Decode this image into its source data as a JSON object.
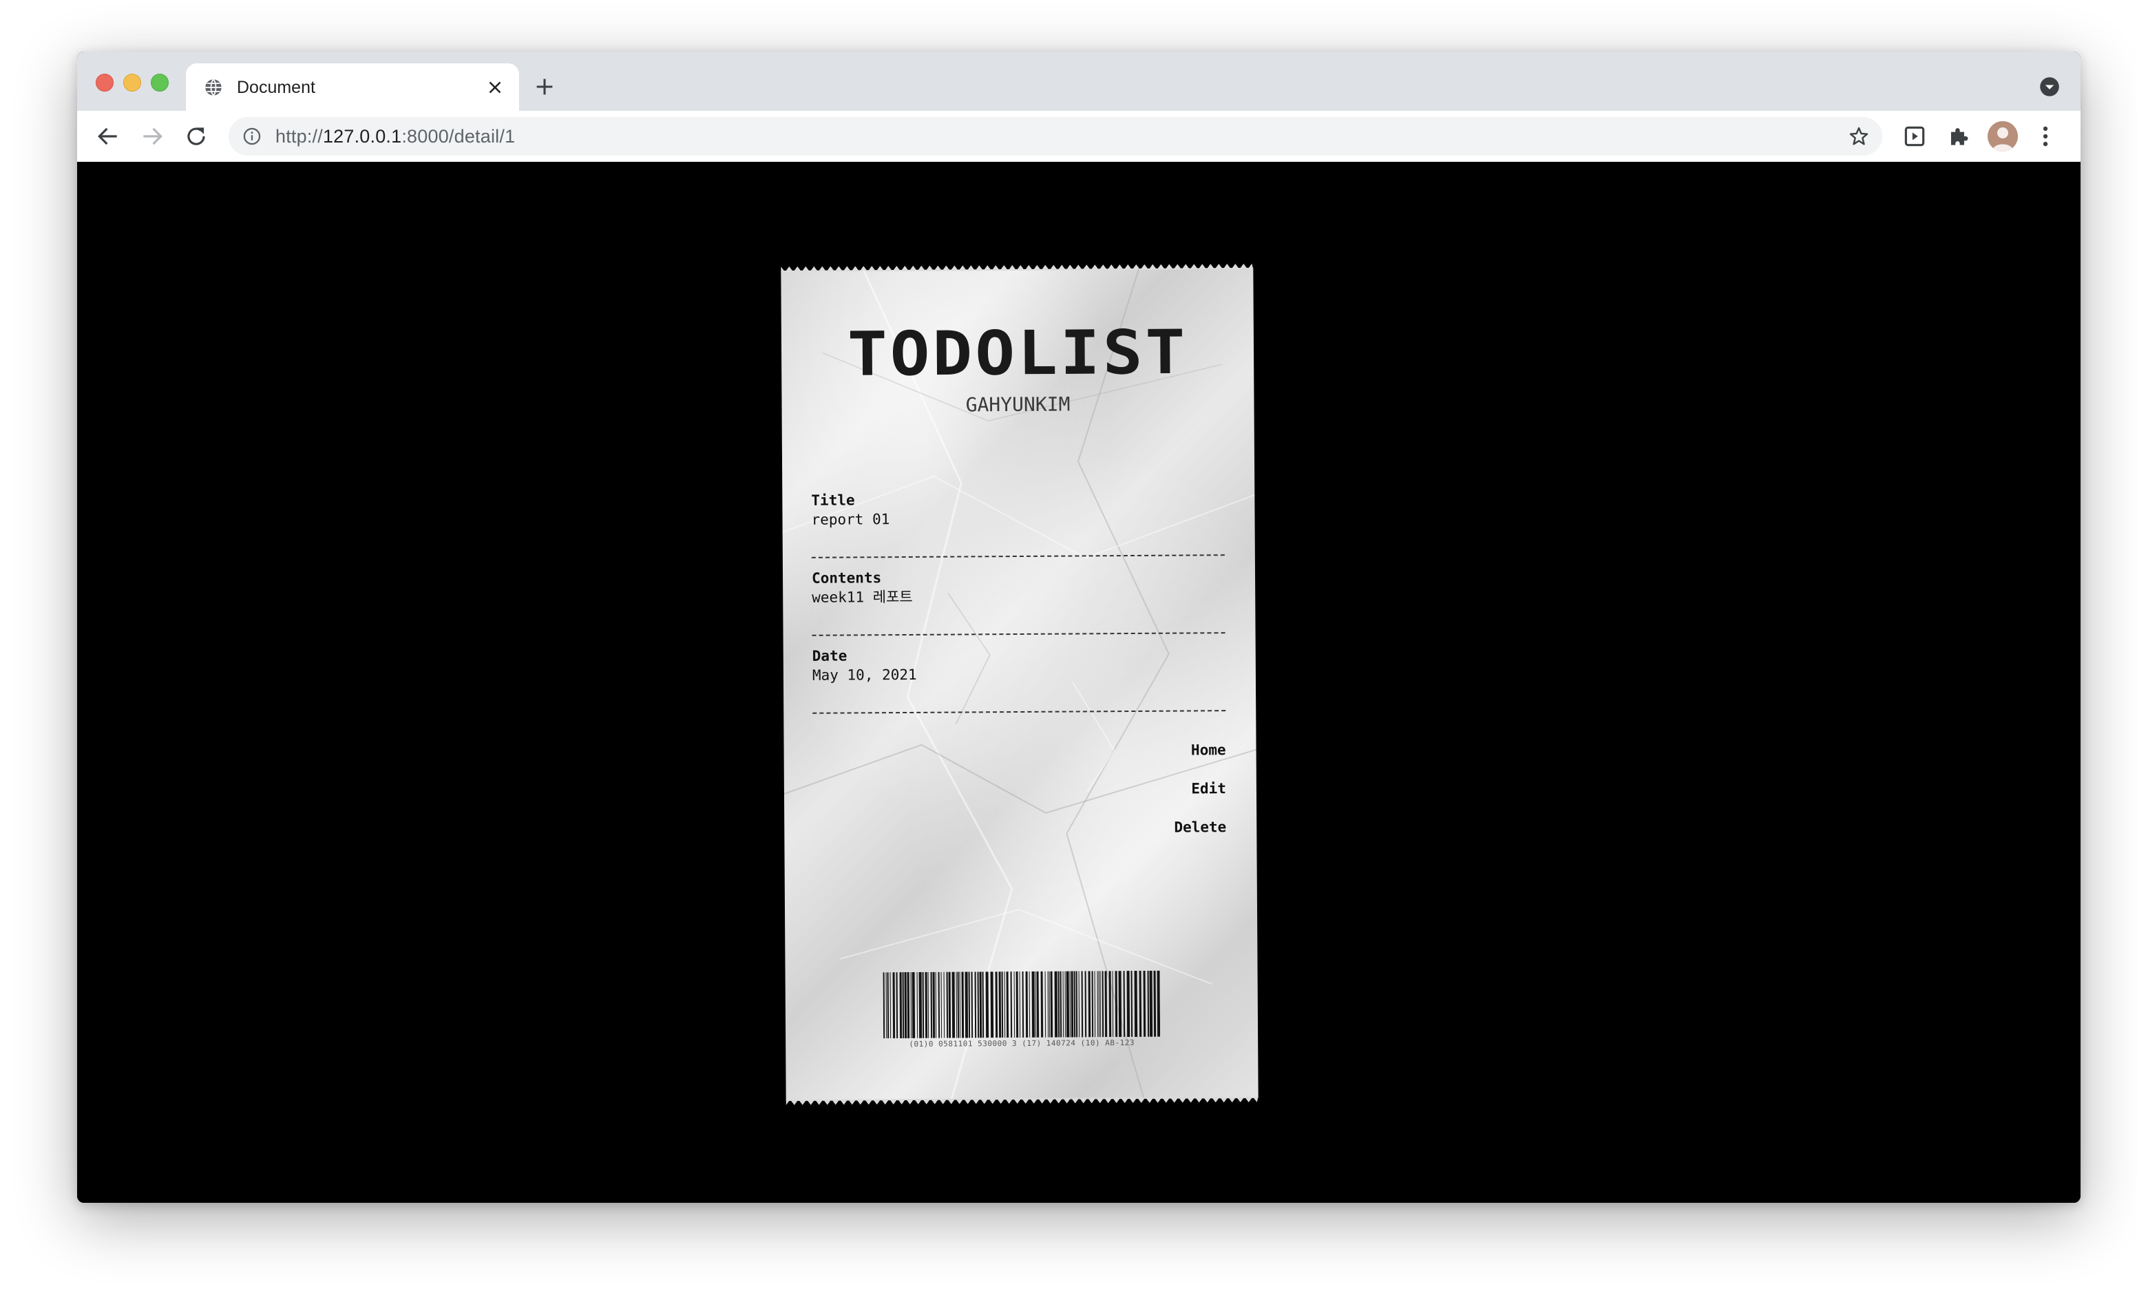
{
  "browser": {
    "tab": {
      "title": "Document",
      "favicon": "globe-icon"
    },
    "url": {
      "scheme": "http://",
      "host": "127.0.0.1",
      "rest": ":8000/detail/1"
    },
    "icons": {
      "back": "arrow-left-icon",
      "forward": "arrow-right-icon",
      "reload": "reload-icon",
      "info": "info-icon",
      "bookmark": "star-icon",
      "media": "media-router-icon",
      "extensions": "puzzle-icon",
      "profile": "avatar",
      "menu": "kebab-menu-icon",
      "new_tab": "plus-icon",
      "tab_search": "chevron-down-circle-icon"
    },
    "colors": {
      "tabstrip": "#dee1e6",
      "toolbar": "#ffffff",
      "omnibox": "#f1f3f4",
      "close": "#ed6a5e",
      "minimize": "#f5bf4f",
      "maximize": "#61c554"
    }
  },
  "receipt": {
    "title": "TODOLIST",
    "subtitle": "GAHYUNKIM",
    "fields": [
      {
        "label": "Title",
        "value": "report 01"
      },
      {
        "label": "Contents",
        "value": "week11 레포트"
      },
      {
        "label": "Date",
        "value": "May 10, 2021"
      }
    ],
    "actions": {
      "home": "Home",
      "edit": "Edit",
      "delete": "Delete"
    },
    "barcode_text": "(01)0 0581101 530000 3 (17) 140724 (10) AB-123"
  },
  "page": {
    "background": "#000000"
  }
}
